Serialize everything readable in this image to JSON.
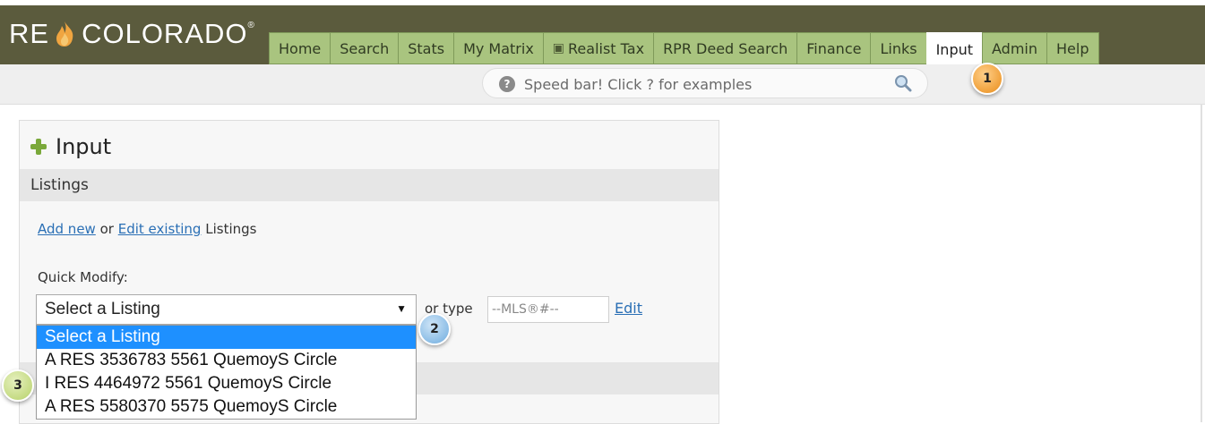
{
  "brand": {
    "logo_left": "RE",
    "logo_right": "COLORADO",
    "registered": "®"
  },
  "nav": {
    "tabs": [
      {
        "label": "Home"
      },
      {
        "label": "Search"
      },
      {
        "label": "Stats"
      },
      {
        "label": "My Matrix"
      },
      {
        "label": "Realist Tax",
        "icon": "external-window-icon"
      },
      {
        "label": "RPR Deed Search"
      },
      {
        "label": "Finance"
      },
      {
        "label": "Links"
      },
      {
        "label": "Input",
        "active": true
      },
      {
        "label": "Admin"
      },
      {
        "label": "Help"
      }
    ]
  },
  "speedbar": {
    "help_glyph": "?",
    "placeholder": "Speed bar! Click ? for examples"
  },
  "callouts": {
    "one": "1",
    "two": "2",
    "three": "3"
  },
  "panel": {
    "title": "Input",
    "section": "Listings",
    "add_new": "Add new",
    "or_text": "or",
    "edit_existing": "Edit existing",
    "listings_text": "Listings",
    "quick_modify_label": "Quick Modify:",
    "select_value": "Select a Listing",
    "or_type": "or type",
    "mls_placeholder": "--MLS®#--",
    "edit": "Edit",
    "options": [
      "Select a Listing",
      "A RES 3536783 5561 QuemoyS Circle",
      "I RES 4464972 5561 QuemoyS Circle",
      "A RES 5580370 5575 QuemoyS Circle"
    ]
  },
  "colors": {
    "header_bg": "#5b5b3d",
    "tab_bg": "#a9c47f",
    "link": "#2a6fb5",
    "highlight": "#1e90ff"
  }
}
